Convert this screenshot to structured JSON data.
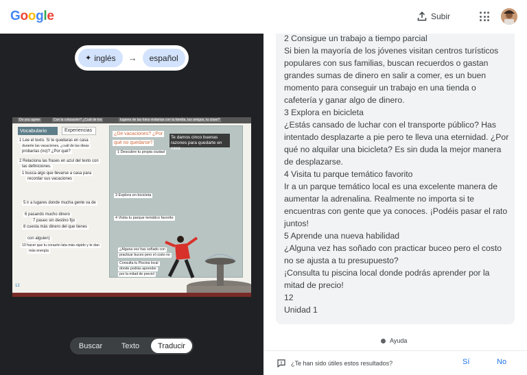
{
  "header": {
    "logo": [
      "G",
      "o",
      "o",
      "g",
      "l",
      "e"
    ],
    "upload_label": "Subir"
  },
  "left": {
    "source_lang": "inglés",
    "target_lang": "español",
    "arrow": "→",
    "image": {
      "top_strip": [
        "Do you agree",
        "Con la cotización? ¿Cuál de los",
        "lugares de las fotos visitarías con tu familia, tus amigos, tu clase?"
      ],
      "vocab_title": "Vocabulario",
      "exp_title": "Experiencias",
      "lines": [
        "1 Lee el texto. Si te quedaras en casa",
        "durante las vacaciones, ¿cuál de las ideas",
        "probarías (no)? ¿Por qué?",
        "2 Relaciona las frases en azul del texto con",
        "las definiciones.",
        "1 busca algo que llevarse a casa para",
        "recordar sus vacaciones",
        "5 ir a lugares donde mucha gente va de",
        "6 pasando mucho dinero",
        "7 paseo sin destino fijo",
        "8 cuesta más dinero del que tienes",
        "con alguien)",
        "10 hacer que tu corazón lata más rápido y te dan",
        "más energía"
      ],
      "panel_title1": "¿De vacaciones? ¿Por",
      "panel_title2": "qué no quedarse?",
      "dark_label": "Te damos cinco buenas razones para quedarte en casa",
      "panel_lines": [
        "1 Descubre tu propia ciudad",
        "3 Explora en bicicleta",
        "4 Visita tu parque temático favorito",
        "¿Alguna vez has soñado con",
        "practicar buceo pero el costo no",
        "Consulta tu Piscina local",
        "donde podrás aprender",
        "por la mitad de precio!"
      ],
      "page_num": "12"
    },
    "tabs": [
      "Buscar",
      "Texto",
      "Traducir"
    ]
  },
  "right": {
    "paragraphs": [
      "2 Consigue un trabajo a tiempo parcial",
      "Si bien la mayoría de los jóvenes visitan centros turísticos populares con sus familias, buscan recuerdos o gastan grandes sumas de dinero en salir a comer, es un buen momento para conseguir un trabajo en una tienda o cafetería y ganar algo de dinero.",
      "3 Explora en bicicleta",
      "¿Estás cansado de luchar con el transporte público? Has intentado desplazarte a pie pero te lleva una eternidad. ¿Por qué no alquilar una bicicleta? Es sin duda la mejor manera de desplazarse.",
      "4 Visita tu parque temático favorito",
      "Ir a un parque temático local es una excelente manera de aumentar la adrenalina. Realmente no importa si te encuentras con gente que ya conoces. ¡Podéis pasar el rato juntos!",
      "5 Aprende una nueva habilidad",
      "¿Alguna vez has soñado con practicar buceo pero el costo no se ajusta a tu presupuesto?",
      "¡Consulta tu piscina local donde podrás aprender por la mitad de precio!",
      "12",
      "Unidad 1"
    ],
    "help_label": "Ayuda",
    "feedback_question": "¿Te han sido útiles estos resultados?",
    "yes": "Sí",
    "no": "No"
  },
  "colors": {
    "dark_bg": "#202124",
    "chip_bg": "#d3e3fd",
    "link_blue": "#1a73e8",
    "result_bg": "#f1f3f4"
  }
}
